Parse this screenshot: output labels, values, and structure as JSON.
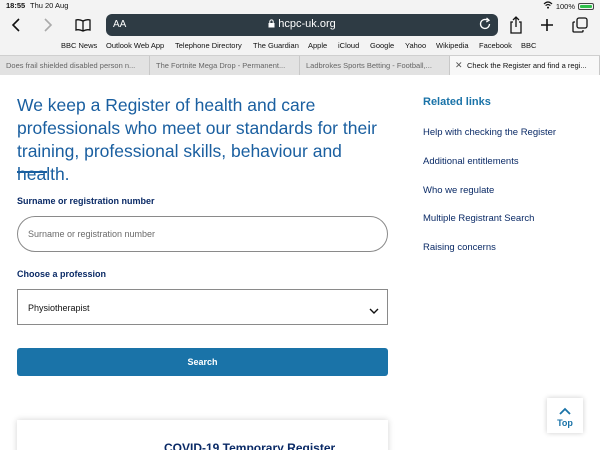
{
  "status_bar": {
    "time": "18:55",
    "date": "Thu 20 Aug",
    "battery": "100%"
  },
  "browser": {
    "text_size_label": "AA",
    "url": "hcpc-uk.org",
    "bookmarks": [
      "BBC News",
      "Outlook Web App",
      "Telephone Directory",
      "The Guardian",
      "Apple",
      "iCloud",
      "Google",
      "Yahoo",
      "Wikipedia",
      "Facebook",
      "BBC"
    ],
    "tabs": [
      "Does frail shielded disabled person n...",
      "The Fortnite Mega Drop - Permanent...",
      "Ladbrokes Sports Betting - Football,...",
      "Check the Register and find a regi..."
    ],
    "icons": [
      "back-icon",
      "forward-icon",
      "reader-icon",
      "lock-icon",
      "reload-icon",
      "share-icon",
      "new-tab-icon",
      "tabs-icon",
      "wifi-icon",
      "battery-icon"
    ]
  },
  "main": {
    "intro": "We keep a Register of health and care professionals who meet our standards for their training, professional skills, behaviour and health.",
    "surname_label": "Surname or registration number",
    "surname_placeholder": "Surname or registration number",
    "profession_label": "Choose a profession",
    "profession_value": "Physiotherapist",
    "search_label": "Search",
    "covid_card_title": "COVID-19 Temporary Register"
  },
  "related": {
    "heading": "Related links",
    "links": [
      "Help with checking the Register",
      "Additional entitlements",
      "Who we regulate",
      "Multiple Registrant Search",
      "Raising concerns"
    ]
  },
  "back_to_top": "Top",
  "colors": {
    "brand_blue": "#1a73a8",
    "heading_blue": "#1a5fa0",
    "navy_text": "#0a2a66",
    "url_bar": "#2e3b44"
  }
}
